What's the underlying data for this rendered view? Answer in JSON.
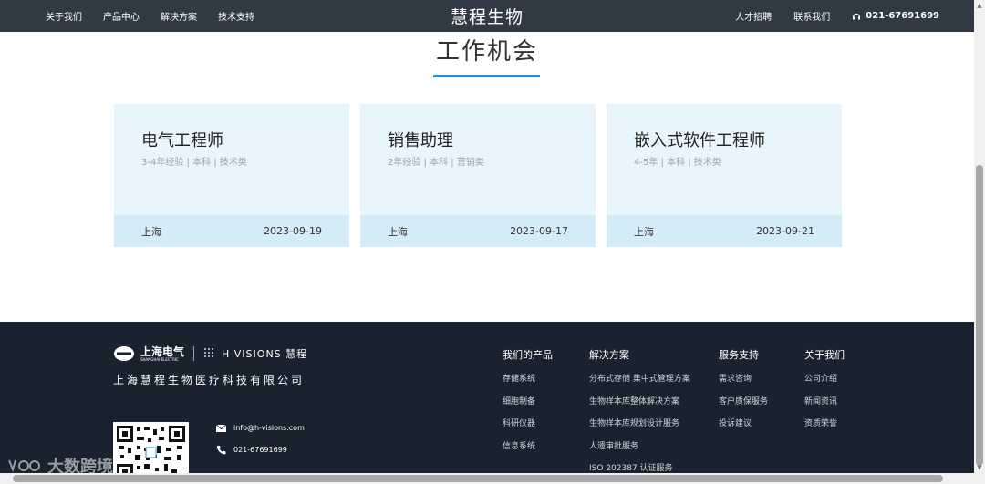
{
  "nav": {
    "left": [
      "关于我们",
      "产品中心",
      "解决方案",
      "技术支持"
    ],
    "brand": "慧程生物",
    "right": [
      "人才招聘",
      "联系我们"
    ],
    "phone": "021-67691699"
  },
  "section": {
    "title": "工作机会"
  },
  "jobs": [
    {
      "title": "电气工程师",
      "meta": "3-4年经验 | 本科 | 技术类",
      "city": "上海",
      "date": "2023-09-19"
    },
    {
      "title": "销售助理",
      "meta": "2年经验 | 本科 | 营销类",
      "city": "上海",
      "date": "2023-09-17"
    },
    {
      "title": "嵌入式软件工程师",
      "meta": "4-5年 | 本科 | 技术类",
      "city": "上海",
      "date": "2023-09-21"
    }
  ],
  "footer": {
    "logo_text_1": "上海电气",
    "logo_sub": "SHANGHAI ELECTRIC",
    "logo_text_2": "H VISIONS 慧程",
    "company": "上海慧程生物医疗科技有限公司",
    "email": "info@h-visions.com",
    "tel": "021-67691699",
    "columns": [
      {
        "title": "我们的产品",
        "items": [
          "存储系统",
          "细胞制备",
          "科研仪器",
          "信息系统"
        ]
      },
      {
        "title": "解决方案",
        "items": [
          "分布式存储 集中式管理方案",
          "生物样本库整体解决方案",
          "生物样本库规划设计服务",
          "人遗审批服务",
          "ISO 202387 认证服务"
        ]
      },
      {
        "title": "服务支持",
        "items": [
          "需求咨询",
          "客户质保服务",
          "投诉建议"
        ]
      },
      {
        "title": "关于我们",
        "items": [
          "公司介绍",
          "新闻资讯",
          "资质荣誉"
        ]
      }
    ]
  },
  "watermark": "大数跨境"
}
